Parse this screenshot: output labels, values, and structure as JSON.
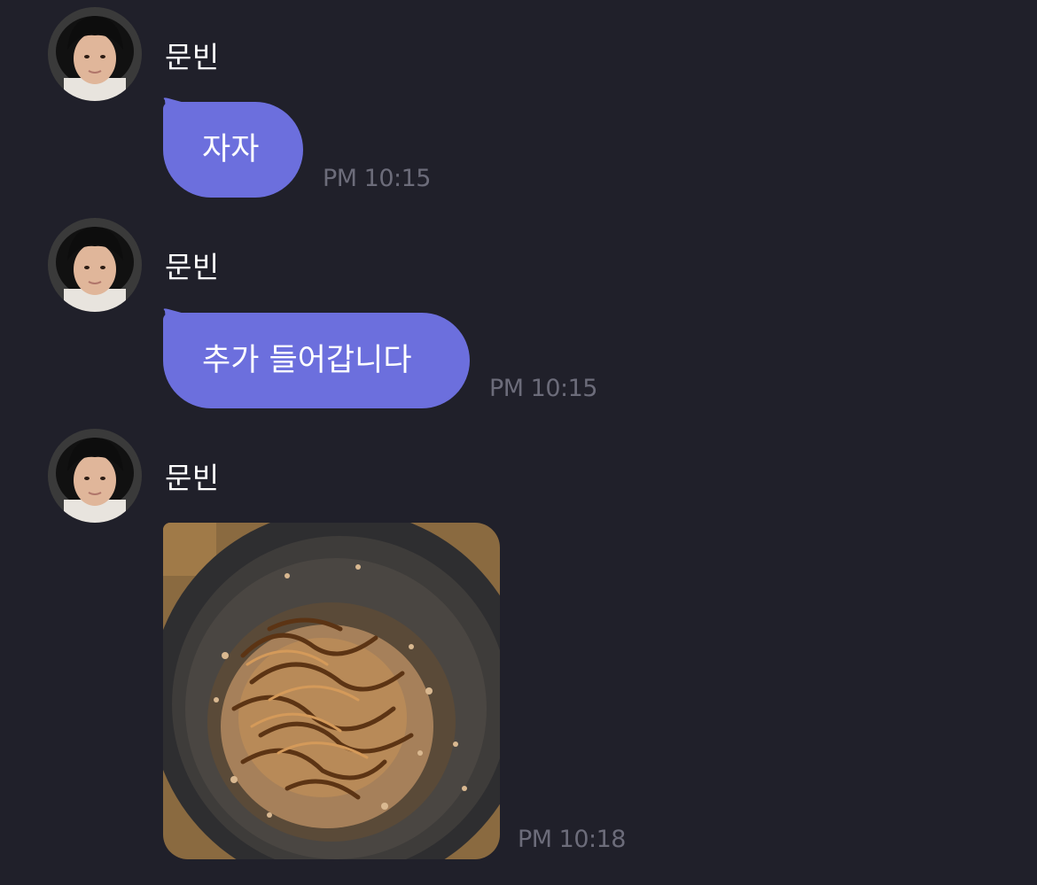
{
  "colors": {
    "background": "#20202a",
    "bubble": "#6c6fdd",
    "name_text": "#ffffff",
    "time_text": "#6c6c7a"
  },
  "messages": [
    {
      "sender": "문빈",
      "type": "text",
      "text": "자자",
      "time": "PM 10:15"
    },
    {
      "sender": "문빈",
      "type": "text",
      "text": "추가 들어갑니다",
      "time": "PM 10:15"
    },
    {
      "sender": "문빈",
      "type": "image",
      "image": "food-photo",
      "time": "PM 10:18"
    }
  ]
}
